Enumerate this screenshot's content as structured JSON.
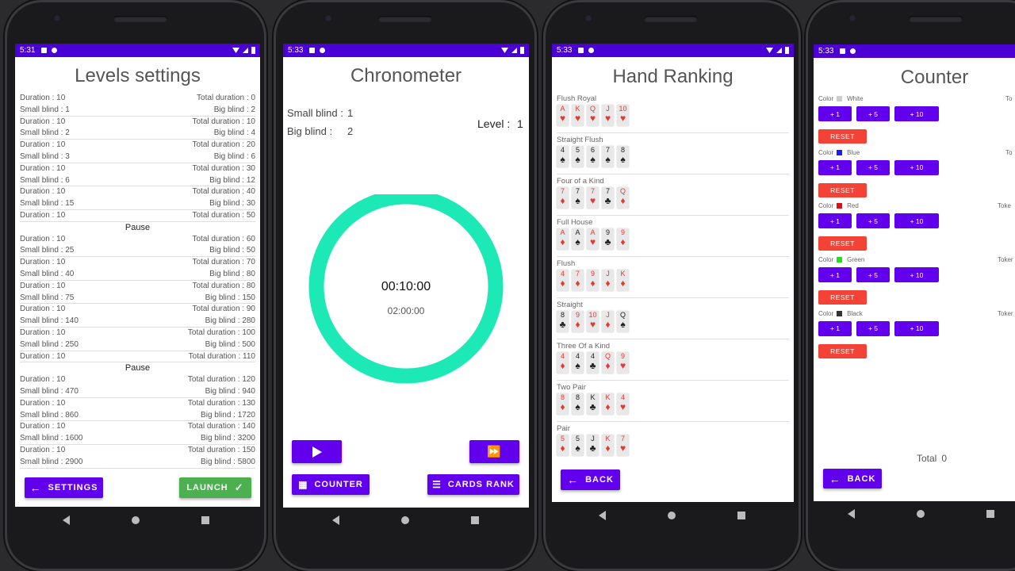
{
  "status_times": [
    "5:31",
    "5:33",
    "5:33",
    "5:33"
  ],
  "levels": {
    "title": "Levels settings",
    "duration_label": "Duration :",
    "small_label": "Small blind :",
    "total_label": "Total duration :",
    "big_label": "Big blind :",
    "pause_label": "Pause",
    "rows": [
      {
        "d": "10",
        "t": "0",
        "s": "1",
        "b": "2"
      },
      {
        "d": "10",
        "t": "10",
        "s": "2",
        "b": "4"
      },
      {
        "d": "10",
        "t": "20",
        "s": "3",
        "b": "6"
      },
      {
        "d": "10",
        "t": "30",
        "s": "6",
        "b": "12"
      },
      {
        "d": "10",
        "t": "40",
        "s": "15",
        "b": "30"
      },
      {
        "pause": true,
        "d": "10",
        "t": "50"
      },
      {
        "d": "10",
        "t": "60",
        "s": "25",
        "b": "50"
      },
      {
        "d": "10",
        "t": "70",
        "s": "40",
        "b": "80"
      },
      {
        "d": "10",
        "t": "80",
        "s": "75",
        "b": "150"
      },
      {
        "d": "10",
        "t": "90",
        "s": "140",
        "b": "280"
      },
      {
        "d": "10",
        "t": "100",
        "s": "250",
        "b": "500"
      },
      {
        "pause": true,
        "d": "10",
        "t": "110"
      },
      {
        "d": "10",
        "t": "120",
        "s": "470",
        "b": "940"
      },
      {
        "d": "10",
        "t": "130",
        "s": "860",
        "b": "1720"
      },
      {
        "d": "10",
        "t": "140",
        "s": "1600",
        "b": "3200"
      },
      {
        "d": "10",
        "t": "150",
        "s": "2900",
        "b": "5800"
      }
    ],
    "settings_label": "SETTINGS",
    "launch_label": "LAUNCH"
  },
  "chrono": {
    "title": "Chronometer",
    "small_blind_label": "Small blind :",
    "small_blind_value": "1",
    "big_blind_label": "Big blind :",
    "big_blind_value": "2",
    "level_label": "Level :",
    "level_value": "1",
    "time_main": "00:10:00",
    "time_sub": "02:00:00",
    "ring_color": "#1de9b6",
    "counter_label": "COUNTER",
    "cards_rank_label": "CARDS RANK"
  },
  "hands": {
    "title": "Hand Ranking",
    "back_label": "BACK",
    "list": [
      {
        "name": "Flush Royal",
        "cards": [
          [
            "A",
            "h"
          ],
          [
            "K",
            "h"
          ],
          [
            "Q",
            "h"
          ],
          [
            "J",
            "h"
          ],
          [
            "10",
            "h"
          ]
        ]
      },
      {
        "name": "Straight Flush",
        "cards": [
          [
            "4",
            "s"
          ],
          [
            "5",
            "s"
          ],
          [
            "6",
            "s"
          ],
          [
            "7",
            "s"
          ],
          [
            "8",
            "s"
          ]
        ]
      },
      {
        "name": "Four of a Kind",
        "cards": [
          [
            "7",
            "d"
          ],
          [
            "7",
            "s"
          ],
          [
            "7",
            "h"
          ],
          [
            "7",
            "c"
          ],
          [
            "Q",
            "d"
          ]
        ]
      },
      {
        "name": "Full House",
        "cards": [
          [
            "A",
            "d"
          ],
          [
            "A",
            "s"
          ],
          [
            "A",
            "h"
          ],
          [
            "9",
            "c"
          ],
          [
            "9",
            "d"
          ]
        ]
      },
      {
        "name": "Flush",
        "cards": [
          [
            "4",
            "d"
          ],
          [
            "7",
            "d"
          ],
          [
            "9",
            "d"
          ],
          [
            "J",
            "d"
          ],
          [
            "K",
            "d"
          ]
        ]
      },
      {
        "name": "Straight",
        "cards": [
          [
            "8",
            "c"
          ],
          [
            "9",
            "d"
          ],
          [
            "10",
            "h"
          ],
          [
            "J",
            "d"
          ],
          [
            "Q",
            "s"
          ]
        ]
      },
      {
        "name": "Three Of a Kind",
        "cards": [
          [
            "4",
            "d"
          ],
          [
            "4",
            "s"
          ],
          [
            "4",
            "c"
          ],
          [
            "Q",
            "d"
          ],
          [
            "9",
            "h"
          ]
        ]
      },
      {
        "name": "Two Pair",
        "cards": [
          [
            "8",
            "d"
          ],
          [
            "8",
            "s"
          ],
          [
            "K",
            "c"
          ],
          [
            "K",
            "d"
          ],
          [
            "4",
            "h"
          ]
        ]
      },
      {
        "name": "Pair",
        "cards": [
          [
            "5",
            "d"
          ],
          [
            "5",
            "s"
          ],
          [
            "J",
            "c"
          ],
          [
            "K",
            "d"
          ],
          [
            "7",
            "h"
          ]
        ]
      }
    ]
  },
  "counter": {
    "title": "Counter",
    "color_label": "Color",
    "reset_label": "RESET",
    "plus1": "+ 1",
    "plus5": "+ 5",
    "plus10": "+ 10",
    "total_label": "Total",
    "total_value": "0",
    "back_label": "BACK",
    "tokens": [
      {
        "name": "White",
        "hex": "#cccccc",
        "tok": "To"
      },
      {
        "name": "Blue",
        "hex": "#1a1aff",
        "tok": "To"
      },
      {
        "name": "Red",
        "hex": "#e01010",
        "tok": "Toke"
      },
      {
        "name": "Green",
        "hex": "#22dd22",
        "tok": "Toker"
      },
      {
        "name": "Black",
        "hex": "#333333",
        "tok": "Toker"
      }
    ]
  }
}
